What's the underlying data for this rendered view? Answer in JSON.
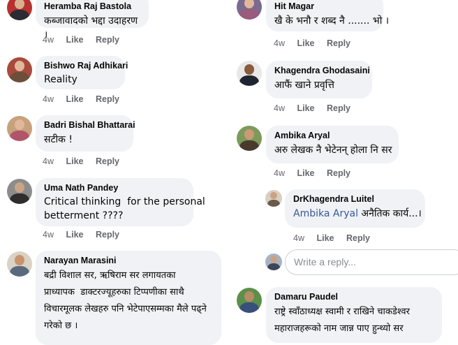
{
  "left_comments": [
    {
      "author": "Heramba Raj Bastola",
      "text": "कब्जावादको भद्दा उदाहरण ।",
      "time": "4w",
      "like": "Like",
      "reply": "Reply"
    },
    {
      "author": "Bishwo Raj Adhikari",
      "text": "Reality",
      "time": "4w",
      "like": "Like",
      "reply": "Reply"
    },
    {
      "author": "Badri Bishal Bhattarai",
      "text": "सटीक !",
      "time": "4w",
      "like": "Like",
      "reply": "Reply"
    },
    {
      "author": "Uma Nath Pandey",
      "text_line1": "Critical thinking  for the personal",
      "text_line2": "betterment ????",
      "time": "4w",
      "like": "Like",
      "reply": "Reply"
    },
    {
      "author": "Narayan Marasini",
      "text_line1": "बद्री विशाल सर, ऋषिराम सर लगायतका",
      "text_line2": "प्राध्यापक  डाक्टरज्यूहरुका टिप्पणीका साथै",
      "text_line3": "विचारमूलक लेखहरु पनि भेटेपाएसम्मका मैले पढ्ने",
      "text_line4": "गरेको छ ।"
    }
  ],
  "right_comments": [
    {
      "author": "Hit Magar",
      "text": "खै के भनौ र शब्द नै ....... भो ।",
      "time": "4w",
      "like": "Like",
      "reply": "Reply"
    },
    {
      "author": "Khagendra Ghodasaini",
      "text": "आफैं खाने प्रवृत्ति",
      "time": "4w",
      "like": "Like",
      "reply": "Reply"
    },
    {
      "author": "Ambika Aryal",
      "text": "अरु लेखक नै भेटेनन् होला नि सर",
      "time": "4w",
      "like": "Like",
      "reply": "Reply"
    },
    {
      "author": "DrKhagendra Luitel",
      "mention": "Ambika Aryal",
      "text": "अनैतिक कार्य...।",
      "time": "4w",
      "like": "Like",
      "reply": "Reply"
    },
    {
      "author": "Damaru Paudel",
      "text_line1": "राष्ट्रे स्वाँठाध्यक्ष स्वामी र राखिने चाकडेश्वर",
      "text_line2": "महाराजहरूको नाम जान्न पाए हुन्थ्यो सर"
    }
  ],
  "reply_input": {
    "placeholder": "Write a reply..."
  }
}
